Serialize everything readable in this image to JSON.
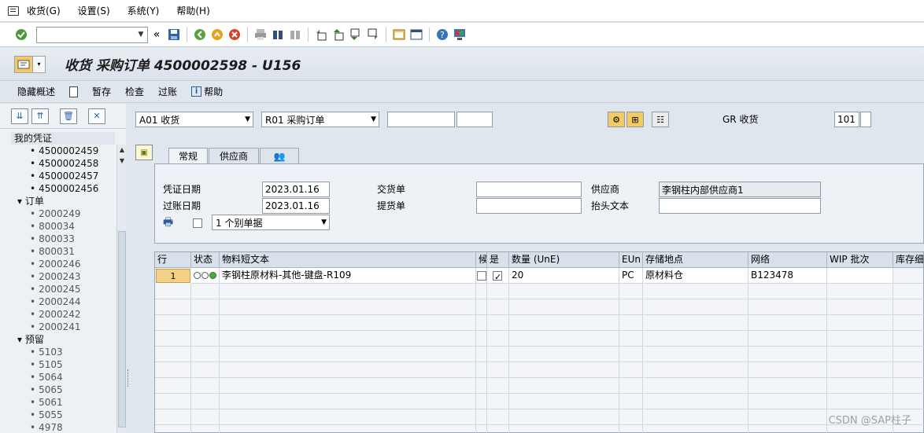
{
  "menu": [
    "收货(G)",
    "设置(S)",
    "系统(Y)",
    "帮助(H)"
  ],
  "title": "收货 采购订单 4500002598 - U156",
  "app_toolbar": {
    "hide_overview": "隐藏概述",
    "hold": "暂存",
    "check": "检查",
    "post": "过账",
    "help": "帮助"
  },
  "tree": {
    "my_docs": "我的凭证",
    "docs": [
      "4500002459",
      "4500002458",
      "4500002457",
      "4500002456"
    ],
    "orders_label": "订单",
    "orders": [
      "2000249",
      "800034",
      "800033",
      "800031",
      "2000246",
      "2000243",
      "2000245",
      "2000244",
      "2000242",
      "2000241"
    ],
    "reservations_label": "预留",
    "reservations": [
      "5103",
      "5105",
      "5064",
      "5065",
      "5061",
      "5055",
      "4978"
    ]
  },
  "header": {
    "transaction": "A01 收货",
    "reference": "R01 采购订单",
    "gr_label": "GR 收货",
    "movement_type": "101"
  },
  "tabs": [
    "常规",
    "供应商"
  ],
  "general": {
    "doc_date_label": "凭证日期",
    "doc_date": "2023.01.16",
    "post_date_label": "过账日期",
    "post_date": "2023.01.16",
    "delivery_note_label": "交货单",
    "bill_of_lading_label": "提货单",
    "vendor_label": "供应商",
    "vendor": "李钢柱内部供应商1",
    "header_text_label": "抬头文本",
    "slip_option": "1 个别单据"
  },
  "grid": {
    "headers": [
      "行",
      "状态",
      "物料短文本",
      "候",
      "是",
      "数量 (UnE)",
      "EUn",
      "存储地点",
      "网络",
      "WIP 批次",
      "库存细分"
    ],
    "rows": [
      {
        "line": "1",
        "material": "李钢柱原材料-其他-键盘-R109",
        "qty": "20",
        "unit": "PC",
        "storage": "原材料仓",
        "network": "B123478",
        "wip": ""
      }
    ]
  },
  "watermark": "CSDN @SAP柱子"
}
